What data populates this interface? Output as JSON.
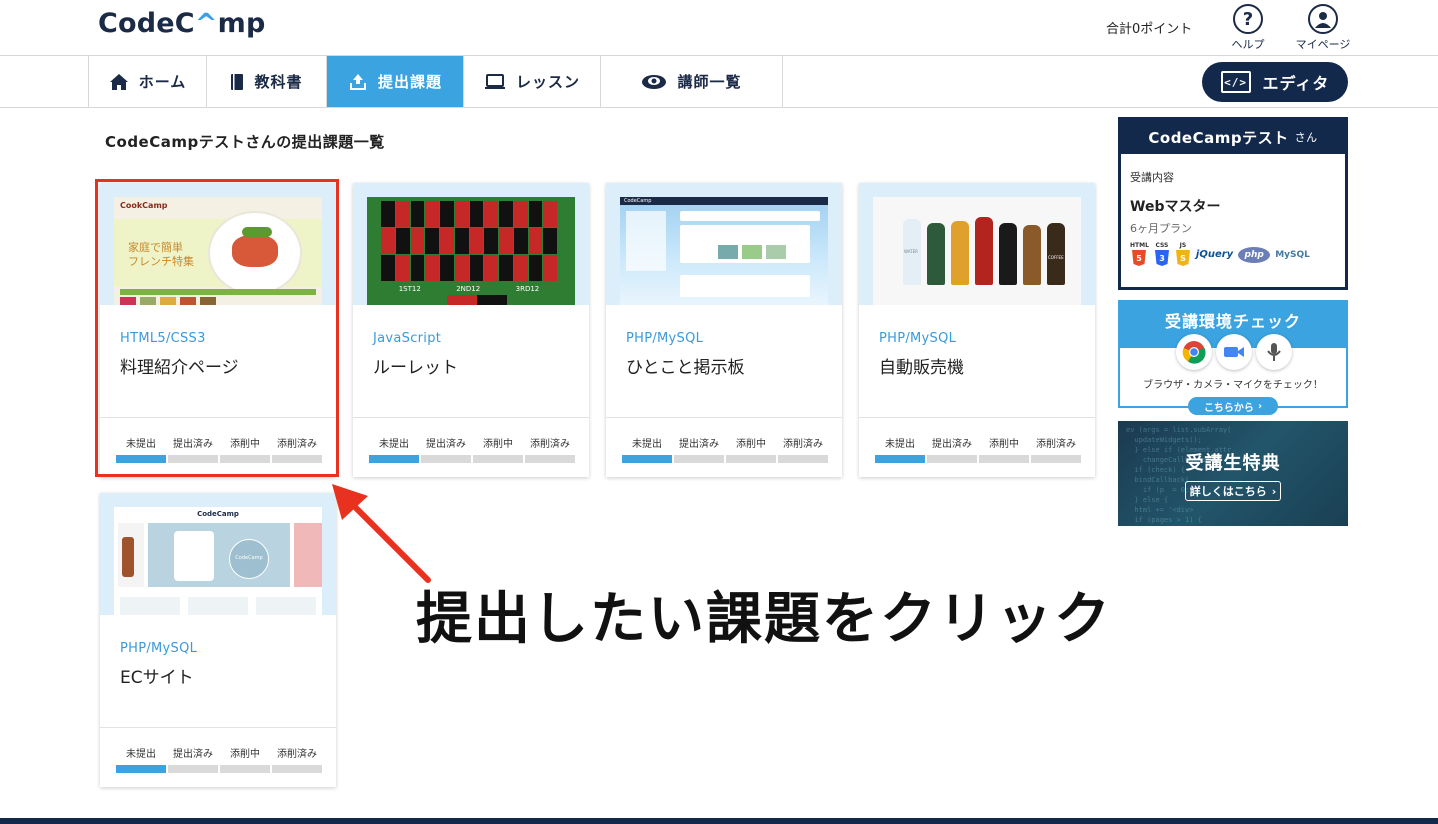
{
  "header": {
    "logo_text_a": "CodeC",
    "logo_text_caret": "^",
    "logo_text_b": "mp",
    "points": "合計0ポイント",
    "help_label": "ヘルプ",
    "help_symbol": "?",
    "mypage_label": "マイページ"
  },
  "nav": {
    "tabs": [
      {
        "label": "ホーム",
        "icon": "home-icon"
      },
      {
        "label": "教科書",
        "icon": "book-icon"
      },
      {
        "label": "提出課題",
        "icon": "upload-icon",
        "active": true
      },
      {
        "label": "レッスン",
        "icon": "laptop-icon"
      },
      {
        "label": "講師一覧",
        "icon": "instructor-icon"
      }
    ],
    "editor_label": "エディタ",
    "editor_icon_text": "</>"
  },
  "page_title": "CodeCampテストさんの提出課題一覧",
  "status_labels": [
    "未提出",
    "提出済み",
    "添削中",
    "添削済み"
  ],
  "cards": [
    {
      "category": "HTML5/CSS3",
      "title": "料理紹介ページ",
      "thumb_text_1": "CookCamp",
      "thumb_text_2": "家庭で簡単",
      "thumb_text_3": "フレンチ特集",
      "current_step": 0
    },
    {
      "category": "JavaScript",
      "title": "ルーレット",
      "thumb_text_1": "1ST12",
      "thumb_text_2": "2ND12",
      "thumb_text_3": "3RD12",
      "current_step": 0
    },
    {
      "category": "PHP/MySQL",
      "title": "ひとこと掲示板",
      "thumb_text_1": "CodeCamp",
      "current_step": 0
    },
    {
      "category": "PHP/MySQL",
      "title": "自動販売機",
      "thumb_text_1": "WATER",
      "thumb_text_2": "COFFEE",
      "current_step": 0
    },
    {
      "category": "PHP/MySQL",
      "title": "ECサイト",
      "thumb_text_1": "CodeCamp",
      "thumb_text_2": "CodeCamp",
      "current_step": 0
    }
  ],
  "profile": {
    "name": "CodeCampテスト",
    "suffix": "さん",
    "course_label": "受講内容",
    "course": "Webマスター",
    "plan": "6ヶ月プラン",
    "tech_logos": [
      "HTML",
      "CSS",
      "JS",
      "jQuery",
      "php",
      "MySQL"
    ]
  },
  "env_check": {
    "title": "受講環境チェック",
    "text": "ブラウザ・カメラ・マイクをチェック！",
    "button": "こちらから"
  },
  "perk": {
    "title": "受講生特典",
    "button": "詳しくはこちら"
  },
  "annotation": "提出したい課題をクリック",
  "colors": {
    "navy": "#13294b",
    "accent": "#3aa3e0",
    "highlight": "#e8321f"
  }
}
